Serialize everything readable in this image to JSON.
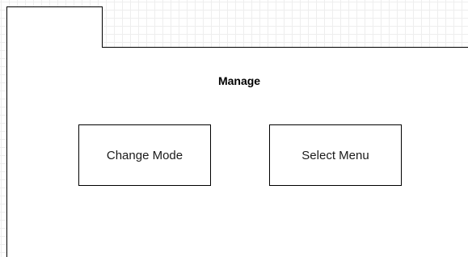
{
  "frame": {
    "title": "Manage"
  },
  "boxes": [
    {
      "label": "Change Mode"
    },
    {
      "label": "Select Menu"
    }
  ],
  "colors": {
    "canvas": "#ffffff",
    "grid": "#eeeeee",
    "stroke": "#000000",
    "text": "#1a1a1a"
  }
}
